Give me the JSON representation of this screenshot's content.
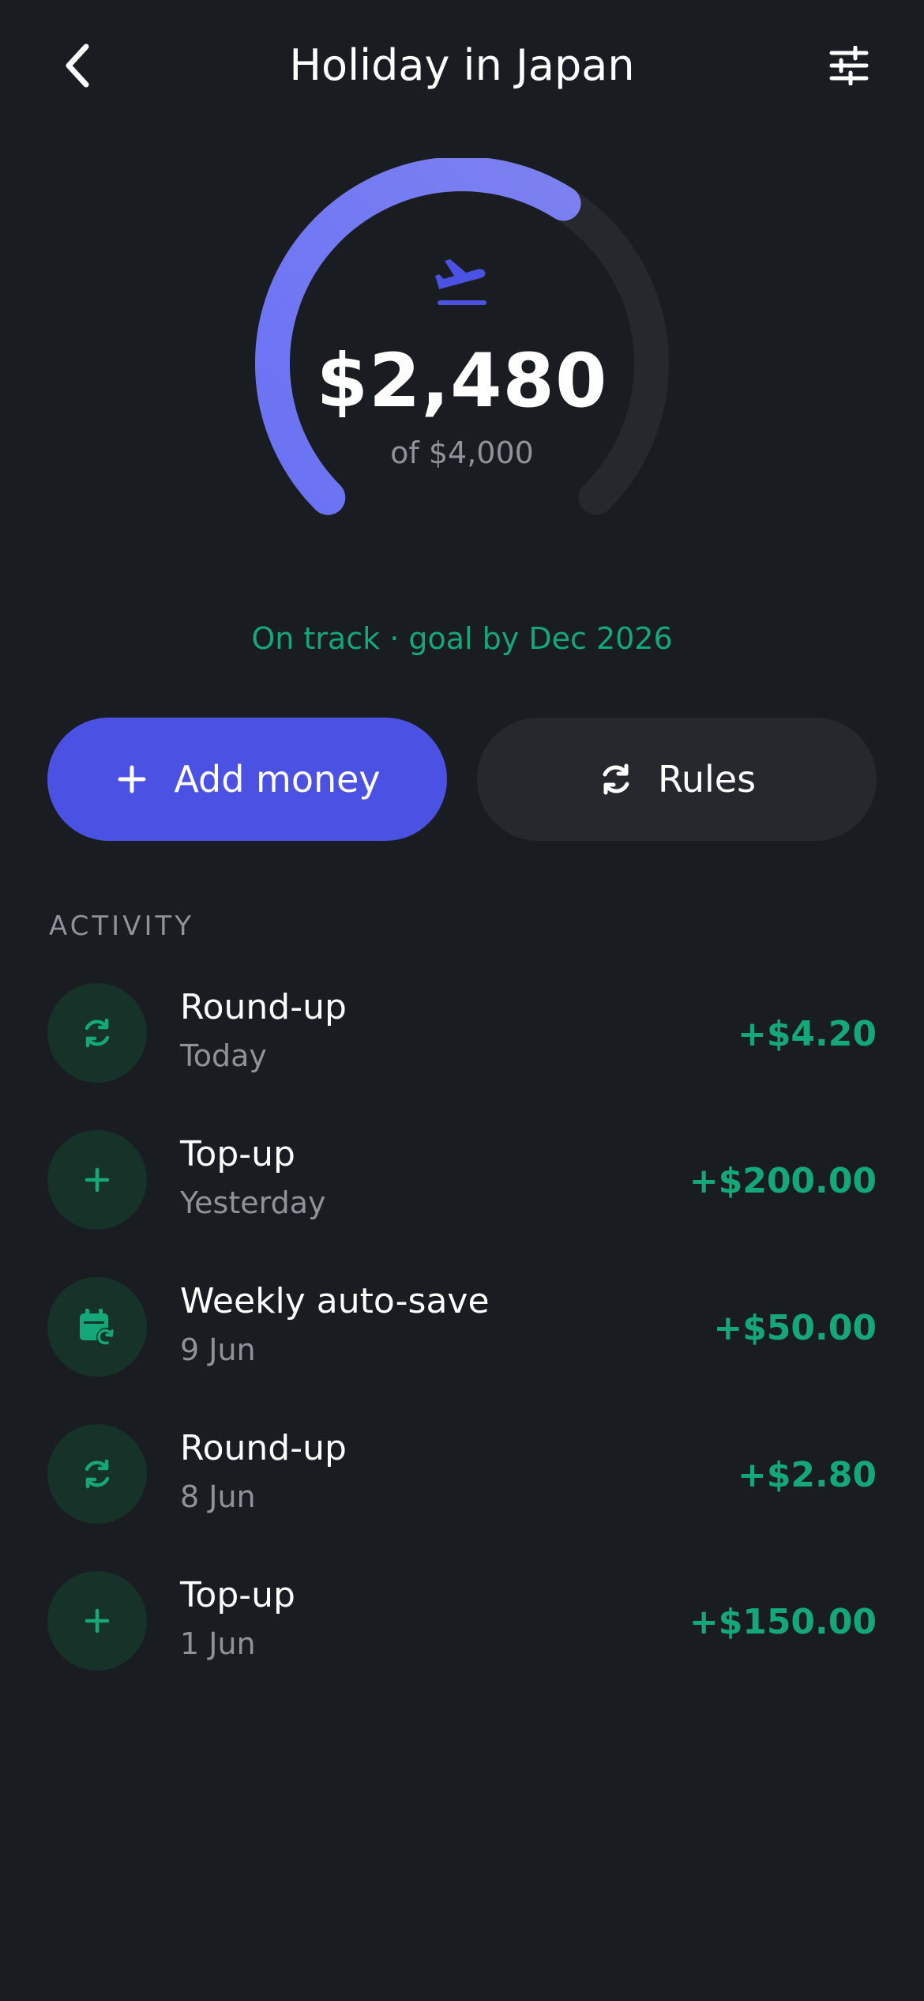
{
  "header": {
    "title": "Holiday in Japan"
  },
  "goal": {
    "saved": "$2,480",
    "target_label": "of $4,000",
    "progress_fraction": 0.62,
    "status": "On track · goal by Dec 2026",
    "icon": "airplane-takeoff-icon"
  },
  "actions": {
    "add_money": "Add money",
    "rules": "Rules"
  },
  "activity": {
    "label": "ACTIVITY",
    "items": [
      {
        "title": "Round-up",
        "date": "Today",
        "amount": "+$4.20",
        "icon": "round-up-icon"
      },
      {
        "title": "Top-up",
        "date": "Yesterday",
        "amount": "+$200.00",
        "icon": "plus-icon"
      },
      {
        "title": "Weekly auto-save",
        "date": "9 Jun",
        "amount": "+$50.00",
        "icon": "calendar-repeat-icon"
      },
      {
        "title": "Round-up",
        "date": "8 Jun",
        "amount": "+$2.80",
        "icon": "round-up-icon"
      },
      {
        "title": "Top-up",
        "date": "1 Jun",
        "amount": "+$150.00",
        "icon": "plus-icon"
      }
    ]
  },
  "colors": {
    "background": "#191c20",
    "accent": "#4b52e3",
    "gauge_gradient": [
      "#6a72f5",
      "#7c80f0"
    ],
    "gauge_track": "#25282c",
    "positive": "#14a878",
    "secondary_text": "#8e939a",
    "icon_circle": "#163229"
  }
}
